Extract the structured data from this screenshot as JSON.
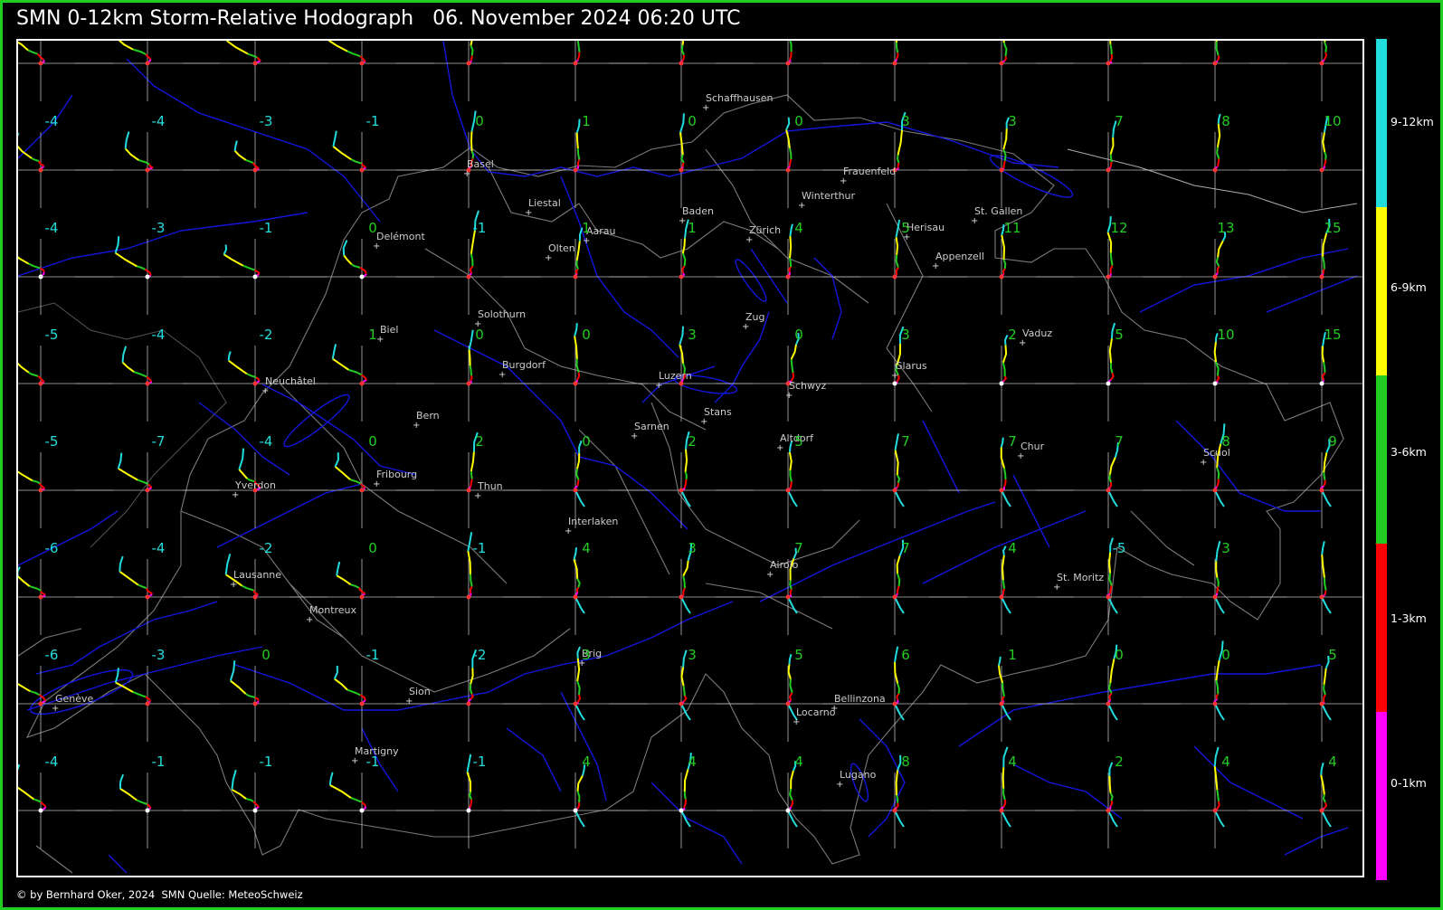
{
  "title": {
    "text": "SMN 0-12km Storm-Relative Hodograph",
    "datetime": "06. November 2024 06:20 UTC"
  },
  "footer": "© by Bernhard Oker, 2024  SMN Quelle: MeteoSchweiz",
  "legend": [
    {
      "label": "9-12km",
      "color": "#22dddd"
    },
    {
      "label": "6-9km",
      "color": "#ffff00"
    },
    {
      "label": "3-6km",
      "color": "#22cc22"
    },
    {
      "label": "1-3km",
      "color": "#ff0000"
    },
    {
      "label": "0-1km",
      "color": "#ff00ff"
    }
  ],
  "grid_values": [
    [
      -4,
      -4,
      -3,
      -1,
      0,
      1,
      0,
      0,
      3,
      3,
      7,
      8,
      10
    ],
    [
      -4,
      -3,
      -1,
      0,
      -1,
      1,
      1,
      4,
      5,
      11,
      12,
      13,
      15
    ],
    [
      -5,
      -4,
      -2,
      1,
      0,
      0,
      3,
      0,
      3,
      2,
      5,
      10,
      15
    ],
    [
      -5,
      -7,
      -4,
      0,
      2,
      0,
      2,
      5,
      7,
      7,
      7,
      8,
      9
    ],
    [
      -6,
      -4,
      -2,
      0,
      -1,
      4,
      3,
      7,
      7,
      4,
      -5,
      3,
      ""
    ],
    [
      -6,
      -3,
      0,
      -1,
      -2,
      3,
      3,
      5,
      6,
      1,
      0,
      0,
      5
    ],
    [
      -4,
      -1,
      -1,
      -1,
      -1,
      4,
      4,
      4,
      8,
      4,
      2,
      4,
      4
    ]
  ],
  "cities": [
    {
      "name": "Schaffhausen"
    },
    {
      "name": "Basel"
    },
    {
      "name": "Frauenfeld"
    },
    {
      "name": "Liestal"
    },
    {
      "name": "Winterthur"
    },
    {
      "name": "Baden"
    },
    {
      "name": "St. Gallen"
    },
    {
      "name": "Delémont"
    },
    {
      "name": "Aarau"
    },
    {
      "name": "Zürich"
    },
    {
      "name": "Herisau"
    },
    {
      "name": "Olten"
    },
    {
      "name": "Appenzell"
    },
    {
      "name": "Solothurn"
    },
    {
      "name": "Zug"
    },
    {
      "name": "Biel"
    },
    {
      "name": "Vaduz"
    },
    {
      "name": "Burgdorf"
    },
    {
      "name": "Glarus"
    },
    {
      "name": "Neuchâtel"
    },
    {
      "name": "Luzern"
    },
    {
      "name": "Schwyz"
    },
    {
      "name": "Bern"
    },
    {
      "name": "Stans"
    },
    {
      "name": "Sarnen"
    },
    {
      "name": "Altdorf"
    },
    {
      "name": "Chur"
    },
    {
      "name": "Scuol"
    },
    {
      "name": "Fribourg"
    },
    {
      "name": "Yverdon"
    },
    {
      "name": "Thun"
    },
    {
      "name": "Interlaken"
    },
    {
      "name": "Airolo"
    },
    {
      "name": "Lausanne"
    },
    {
      "name": "St. Moritz"
    },
    {
      "name": "Montreux"
    },
    {
      "name": "Brig"
    },
    {
      "name": "Genève"
    },
    {
      "name": "Sion"
    },
    {
      "name": "Bellinzona"
    },
    {
      "name": "Locarno"
    },
    {
      "name": "Martigny"
    },
    {
      "name": "Lugano"
    }
  ]
}
